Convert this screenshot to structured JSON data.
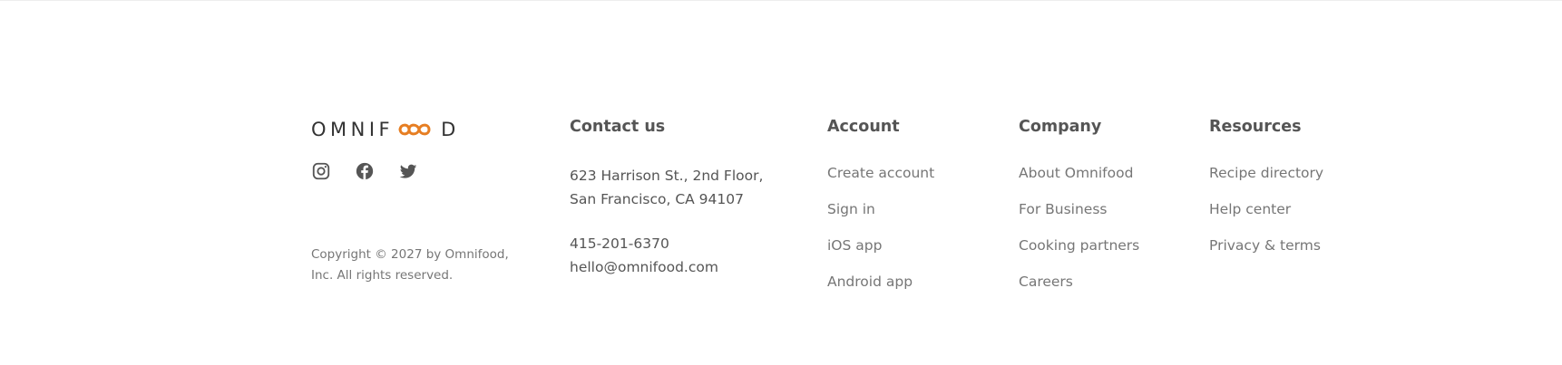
{
  "brand": {
    "logo_text_left": "OMNIF",
    "logo_text_right": "D",
    "accent_color": "#e67e22",
    "logo_icon": "infinity-icon"
  },
  "socials": [
    {
      "name": "instagram-icon"
    },
    {
      "name": "facebook-icon"
    },
    {
      "name": "twitter-icon"
    }
  ],
  "copyright": "Copyright © 2027 by Omnifood, Inc. All rights reserved.",
  "contact": {
    "heading": "Contact us",
    "address_line1": "623 Harrison St., 2nd Floor,",
    "address_line2": "San Francisco, CA 94107",
    "phone": "415-201-6370",
    "email": "hello@omnifood.com"
  },
  "account": {
    "heading": "Account",
    "links": [
      "Create account",
      "Sign in",
      "iOS app",
      "Android app"
    ]
  },
  "company": {
    "heading": "Company",
    "links": [
      "About Omnifood",
      "For Business",
      "Cooking partners",
      "Careers"
    ]
  },
  "resources": {
    "heading": "Resources",
    "links": [
      "Recipe directory",
      "Help center",
      "Privacy & terms"
    ]
  }
}
